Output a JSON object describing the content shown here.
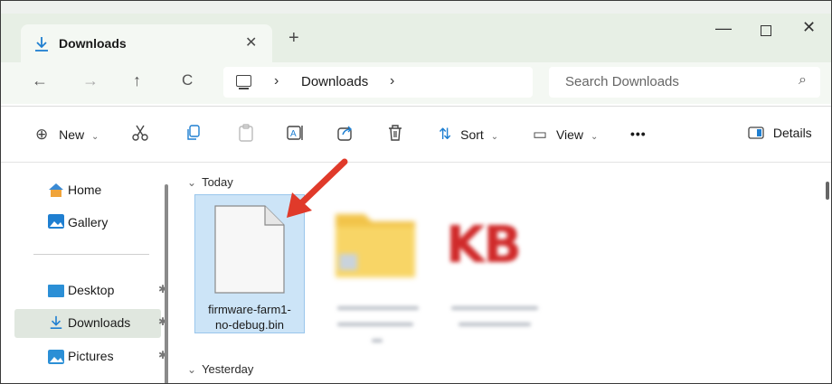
{
  "window": {
    "tab_title": "Downloads",
    "tab_close": "✕",
    "new_tab": "+",
    "minimize": "—",
    "close": "✕"
  },
  "nav": {
    "back": "←",
    "forward": "→",
    "up": "↑",
    "refresh": "C",
    "separator": "›",
    "location": "Downloads",
    "search_placeholder": "Search Downloads",
    "search_icon": "⌕"
  },
  "toolbar": {
    "new_label": "New",
    "sort_label": "Sort",
    "view_label": "View",
    "more": "•••",
    "details_label": "Details",
    "caret": "⌄"
  },
  "sidebar": {
    "items": [
      {
        "label": "Home",
        "icon": "home-icon",
        "color": "#e7a23a"
      },
      {
        "label": "Gallery",
        "icon": "gallery-icon",
        "color": "#1f7fd1"
      },
      {
        "label": "Desktop",
        "icon": "desktop-icon",
        "color": "#2b8fd6"
      },
      {
        "label": "Downloads",
        "icon": "download-icon",
        "color": "#1f7fd1"
      },
      {
        "label": "Pictures",
        "icon": "pictures-icon",
        "color": "#2b8fd6"
      }
    ],
    "pin": "📌"
  },
  "content": {
    "groups": [
      {
        "label": "Today"
      },
      {
        "label": "Yesterday"
      }
    ],
    "file": {
      "name_line1": "firmware-farm1-",
      "name_line2": "no-debug.bin"
    },
    "blurred_kb_text": "KB"
  },
  "colors": {
    "accent": "#1f7fd1",
    "selection": "#cce4f7",
    "annotation_arrow": "#e03a2a"
  }
}
